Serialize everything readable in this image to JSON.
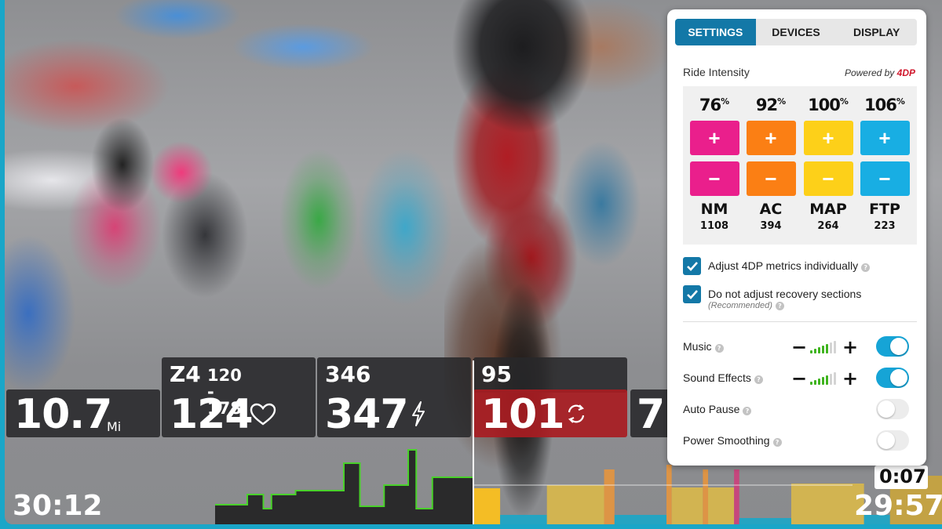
{
  "metrics": {
    "distance": {
      "value": "10.7",
      "unit": "Mi"
    },
    "heart_rate": {
      "zone": "Z4",
      "zone_range": "120 - 178",
      "value": "124",
      "icon": "heart-icon"
    },
    "power": {
      "target": "346",
      "value": "347",
      "icon": "lightning-icon"
    },
    "cadence": {
      "target": "95",
      "value": "101",
      "icon": "refresh-icon",
      "status_color": "#a81c22"
    },
    "speed_partial": {
      "value": "7."
    }
  },
  "timers": {
    "elapsed": "30:12",
    "interval_remaining": "0:07",
    "remaining": "29:57"
  },
  "workout_chart": {
    "completed_power_trace": [
      0.25,
      0.25,
      0.25,
      0.25,
      0.38,
      0.38,
      0.2,
      0.38,
      0.38,
      0.38,
      0.43,
      0.43,
      0.43,
      0.43,
      0.43,
      0.43,
      0.78,
      0.78,
      0.23,
      0.23,
      0.23,
      0.5,
      0.5,
      0.5,
      0.95,
      0.2,
      0.2,
      0.6,
      0.6,
      0.6,
      0.6,
      0.6
    ],
    "upcoming_segments": [
      {
        "zone_color": "#ffc21a",
        "intensity": 0.46,
        "width": 0.05
      },
      {
        "zone_color": "#1aa6c8",
        "intensity": 0.12,
        "width": 0.09
      },
      {
        "zone_color": "#d9b84a",
        "intensity": 0.5,
        "width": 0.11
      },
      {
        "zone_color": "#e6953e",
        "intensity": 0.7,
        "width": 0.02
      },
      {
        "zone_color": "#1aa6c8",
        "intensity": 0.12,
        "width": 0.1
      },
      {
        "zone_color": "#e6953e",
        "intensity": 0.76,
        "width": 0.01
      },
      {
        "zone_color": "#d9b84a",
        "intensity": 0.47,
        "width": 0.06
      },
      {
        "zone_color": "#e6953e",
        "intensity": 0.7,
        "width": 0.01
      },
      {
        "zone_color": "#d9b84a",
        "intensity": 0.47,
        "width": 0.05
      },
      {
        "zone_color": "#cc3f7b",
        "intensity": 0.7,
        "width": 0.01
      },
      {
        "zone_color": "#1aa6c8",
        "intensity": 0.08,
        "width": 0.1
      },
      {
        "zone_color": "#d9b84a",
        "intensity": 0.52,
        "width": 0.14
      },
      {
        "zone_color": "#1aa6c8",
        "intensity": 0.12,
        "width": 0.05
      },
      {
        "zone_color": "#c9a43c",
        "intensity": 0.62,
        "width": 0.1
      }
    ]
  },
  "settings_panel": {
    "tabs": [
      {
        "label": "SETTINGS",
        "active": true
      },
      {
        "label": "DEVICES",
        "active": false
      },
      {
        "label": "DISPLAY",
        "active": false
      }
    ],
    "ride_intensity": {
      "label": "Ride Intensity",
      "powered_by": "Powered by",
      "brand": "4DP",
      "plus_symbol": "+",
      "minus_symbol": "−",
      "pct_symbol": "%",
      "metrics": [
        {
          "name": "NM",
          "percent": "76",
          "value": "1108",
          "color": "#ea1f8c"
        },
        {
          "name": "AC",
          "percent": "92",
          "value": "394",
          "color": "#fb7f14"
        },
        {
          "name": "MAP",
          "percent": "100",
          "value": "264",
          "color": "#fdd019"
        },
        {
          "name": "FTP",
          "percent": "106",
          "value": "223",
          "color": "#18aee3"
        }
      ]
    },
    "checkboxes": [
      {
        "label": "Adjust 4DP metrics individually",
        "sub": "",
        "checked": true
      },
      {
        "label": "Do not adjust recovery sections",
        "sub": "(Recommended)",
        "checked": true
      }
    ],
    "help_symbol": "?",
    "settings": [
      {
        "label": "Music",
        "volume_level": 5,
        "volume_max": 7,
        "enabled": true
      },
      {
        "label": "Sound Effects",
        "volume_level": 5,
        "volume_max": 7,
        "enabled": true
      },
      {
        "label": "Auto Pause",
        "enabled": false
      },
      {
        "label": "Power Smoothing",
        "enabled": false
      }
    ],
    "volume_minus": "−",
    "volume_plus": "+",
    "accent_color": "#1378a7",
    "toggle_on_color": "#16a4d6"
  }
}
